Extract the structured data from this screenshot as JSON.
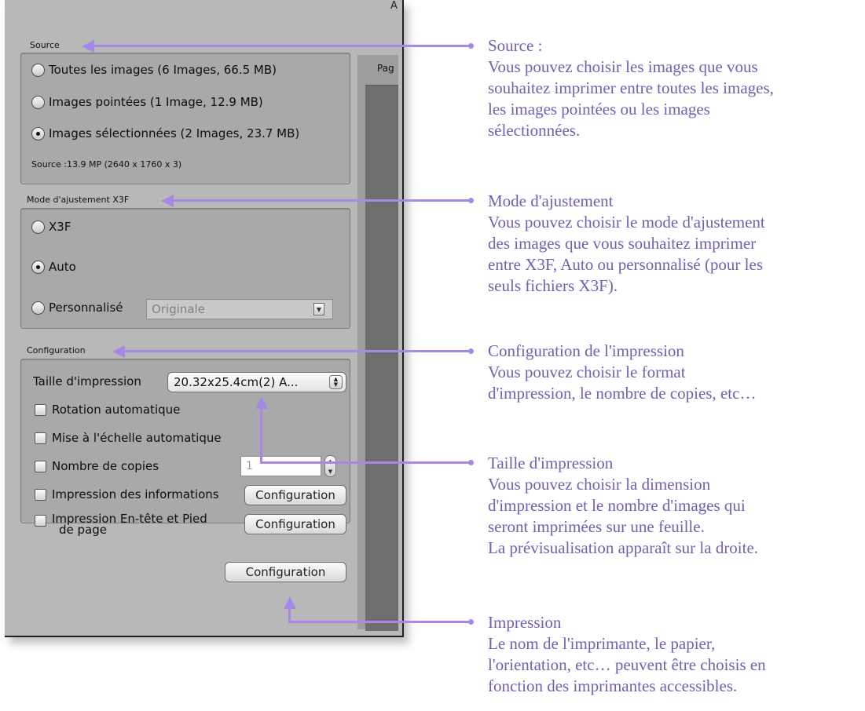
{
  "dialog": {
    "top_peek": "A",
    "preview_label": "Pag",
    "source": {
      "label": "Source",
      "options": [
        {
          "label": "Toutes les images  (6 Images, 66.5 MB)",
          "selected": false
        },
        {
          "label": "Images pointées  (1 Image, 12.9 MB)",
          "selected": false
        },
        {
          "label": "Images sélectionnées  (2 Images, 23.7 MB)",
          "selected": true
        }
      ],
      "info": "Source :13.9 MP (2640 x 1760 x 3)"
    },
    "mode": {
      "label": "Mode d'ajustement X3F",
      "options": [
        {
          "label": "X3F",
          "selected": false
        },
        {
          "label": "Auto",
          "selected": true
        },
        {
          "label": "Personnalisé",
          "selected": false
        }
      ],
      "custom_value": "Originale"
    },
    "configuration": {
      "label": "Configuration",
      "print_size_label": "Taille d'impression",
      "print_size_value": "20.32x25.4cm(2) A...",
      "rotation_label": "Rotation automatique",
      "scale_label": "Mise à l'échelle automatique",
      "copies_label": "Nombre de copies",
      "copies_value": "1",
      "info_label": "Impression des informations",
      "header_footer_label_line1": "Impression En-tête et Pied",
      "header_footer_label_line2": "de page",
      "config_button": "Configuration"
    },
    "print_button": "Configuration"
  },
  "annotations": {
    "source": {
      "title": "Source :",
      "lines": [
        "Vous pouvez choisir les images que vous",
        "souhaitez imprimer entre toutes les images,",
        "les images pointées ou les images",
        "sélectionnées."
      ]
    },
    "mode": {
      "title": "Mode d'ajustement",
      "lines": [
        "Vous pouvez choisir le mode d'ajustement",
        "des images que vous souhaitez imprimer",
        "entre X3F, Auto ou personnalisé (pour les",
        "seuls fichiers X3F)."
      ]
    },
    "configuration": {
      "title": "Configuration de l'impression",
      "lines": [
        "Vous pouvez choisir le format",
        "d'impression, le nombre de copies, etc…"
      ]
    },
    "print_size": {
      "title": "Taille d'impression",
      "lines": [
        "Vous pouvez choisir la dimension",
        "d'impression et le nombre d'images qui",
        "seront imprimées sur une feuille.",
        "La prévisualisation apparaît sur la droite."
      ]
    },
    "print": {
      "title": "Impression",
      "lines": [
        "Le nom de l'imprimante, le papier,",
        "l'orientation, etc… peuvent être choisis en",
        "fonction des imprimantes accessibles."
      ]
    }
  },
  "colors": {
    "annotation": "#6b63b3",
    "connector": "#a689e6",
    "panel": "#b8b8b8"
  }
}
